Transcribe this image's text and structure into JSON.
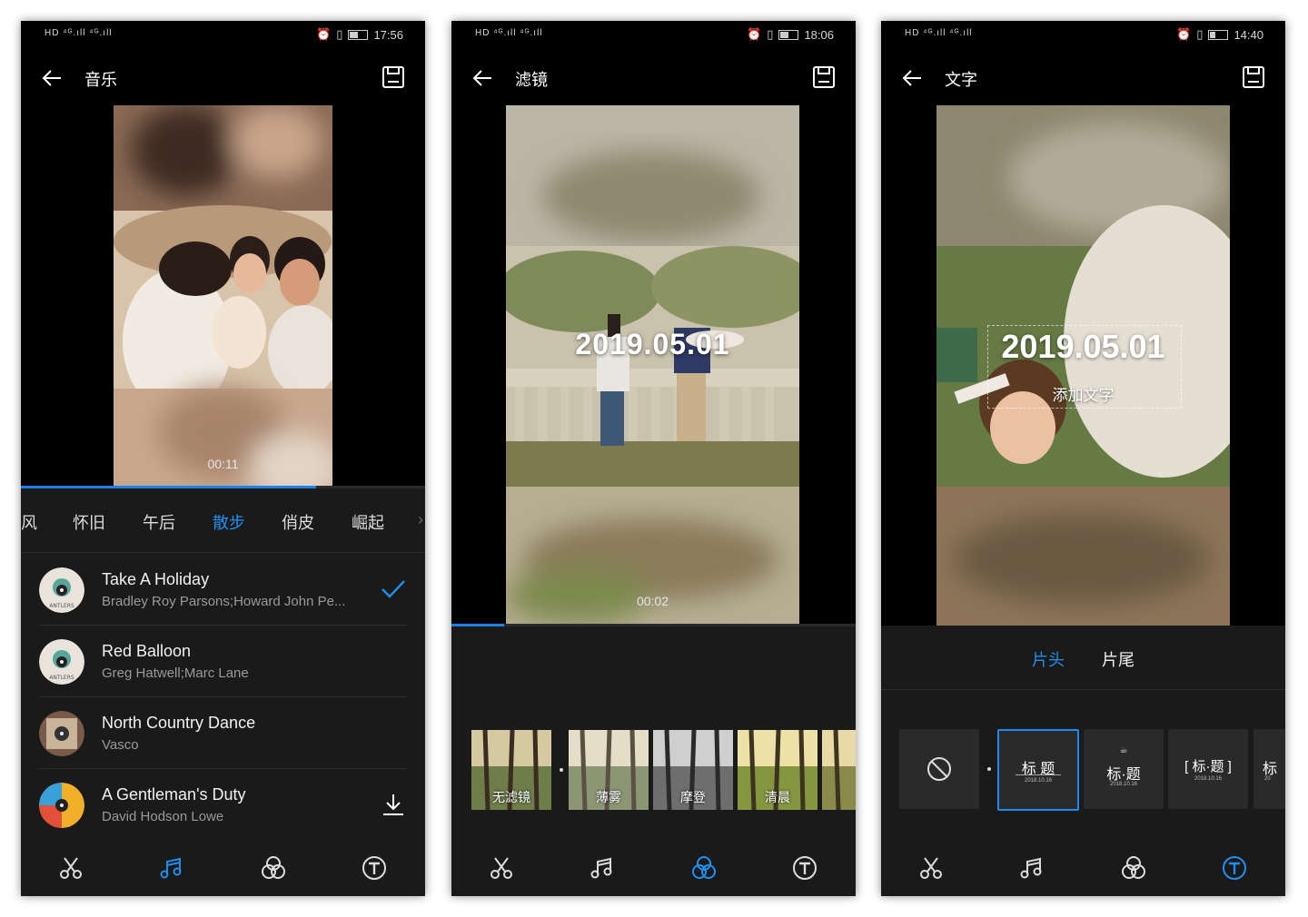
{
  "colors": {
    "accent": "#1f8ff0",
    "panel": "#1a1a1a",
    "background": "#000000"
  },
  "screens": [
    {
      "status": {
        "left": "HD ⁴ᴳ.ıll ⁴ᴳ.ıll",
        "time": "17:56"
      },
      "title": "音乐",
      "video": {
        "timestamp": "00:11",
        "progress": 0.73
      },
      "categories": [
        "风",
        "怀旧",
        "午后",
        "散步",
        "俏皮",
        "崛起"
      ],
      "active_category": "散步",
      "songs": [
        {
          "title": "Take A Holiday",
          "artist": "Bradley Roy Parsons;Howard John Pe...",
          "status": "selected"
        },
        {
          "title": "Red Balloon",
          "artist": "Greg  Hatwell;Marc  Lane",
          "status": ""
        },
        {
          "title": "North Country Dance",
          "artist": "Vasco",
          "status": ""
        },
        {
          "title": "A Gentleman's Duty",
          "artist": "David Hodson Lowe",
          "status": "download"
        }
      ],
      "nav": [
        "cut-icon",
        "music-icon",
        "filter-icon",
        "text-icon"
      ],
      "nav_active": 1
    },
    {
      "status": {
        "left": "HD ⁴ᴳ.ıll ⁴ᴳ.ıll",
        "time": "18:06"
      },
      "title": "滤镜",
      "video": {
        "timestamp": "00:02",
        "overlay_text": "2019.05.01",
        "progress": 0.13
      },
      "filters": [
        "无滤镜",
        "薄雾",
        "摩登",
        "清晨"
      ],
      "nav": [
        "cut-icon",
        "music-icon",
        "filter-icon",
        "text-icon"
      ],
      "nav_active": 2
    },
    {
      "status": {
        "left": "HD ⁴ᴳ.ıll ⁴ᴳ.ıll",
        "time": "14:40"
      },
      "title": "文字",
      "video": {
        "overlay_text": "2019.05.01",
        "overlay_subtext": "添加文字"
      },
      "tabs": [
        "片头",
        "片尾"
      ],
      "active_tab": "片头",
      "templates": [
        {
          "kind": "none",
          "label": "",
          "date": ""
        },
        {
          "kind": "title",
          "label": "标 题",
          "date": "2018.10.16"
        },
        {
          "kind": "title-cup",
          "label": "标·题",
          "date": "2018.10.16"
        },
        {
          "kind": "title-bracket",
          "label": "[ 标·题 ]",
          "date": "2018.10.16"
        },
        {
          "kind": "partial",
          "label": "标",
          "date": "20"
        }
      ],
      "selected_template": 1,
      "nav": [
        "cut-icon",
        "music-icon",
        "filter-icon",
        "text-icon"
      ],
      "nav_active": 3
    }
  ]
}
